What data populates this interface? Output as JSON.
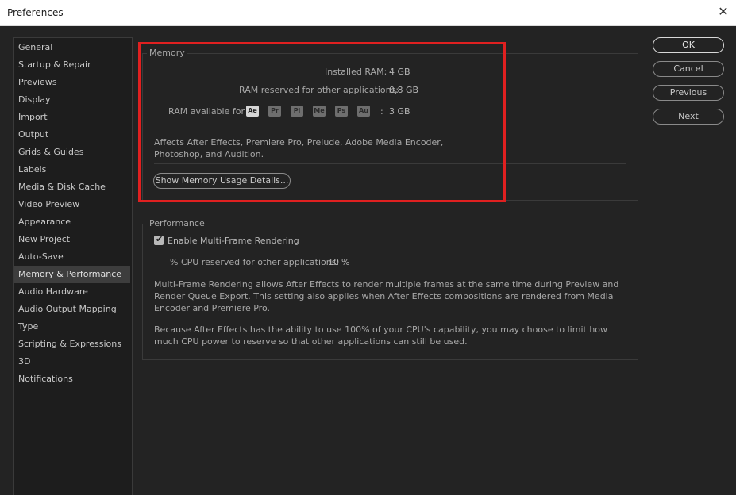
{
  "window": {
    "title": "Preferences"
  },
  "sidebar": {
    "items": [
      {
        "label": "General"
      },
      {
        "label": "Startup & Repair"
      },
      {
        "label": "Previews"
      },
      {
        "label": "Display"
      },
      {
        "label": "Import"
      },
      {
        "label": "Output"
      },
      {
        "label": "Grids & Guides"
      },
      {
        "label": "Labels"
      },
      {
        "label": "Media & Disk Cache"
      },
      {
        "label": "Video Preview"
      },
      {
        "label": "Appearance"
      },
      {
        "label": "New Project"
      },
      {
        "label": "Auto-Save"
      },
      {
        "label": "Memory & Performance"
      },
      {
        "label": "Audio Hardware"
      },
      {
        "label": "Audio Output Mapping"
      },
      {
        "label": "Type"
      },
      {
        "label": "Scripting & Expressions"
      },
      {
        "label": "3D"
      },
      {
        "label": "Notifications"
      }
    ],
    "selected": "Memory & Performance"
  },
  "memory": {
    "title": "Memory",
    "installed_label": "Installed RAM:",
    "installed_value": "4 GB",
    "reserved_label": "RAM reserved for other applications:",
    "reserved_value": "0,8 GB",
    "available_label": "RAM available for",
    "apps": [
      "Ae",
      "Pr",
      "Pl",
      "Me",
      "Ps",
      "Au"
    ],
    "available_sep": ":",
    "available_value": "3 GB",
    "desc_line1": "Affects After Effects, Premiere Pro, Prelude, Adobe Media Encoder,",
    "desc_line2": "Photoshop, and Audition.",
    "details_button": "Show Memory Usage Details..."
  },
  "performance": {
    "title": "Performance",
    "mfr_label": "Enable Multi-Frame Rendering",
    "mfr_checked": true,
    "cpu_label": "% CPU reserved for other applications:",
    "cpu_value": "10",
    "cpu_unit": "%",
    "para1_line1": "Multi-Frame Rendering allows After Effects to render multiple frames at the same time during Preview and",
    "para1_line2": "Render Queue Export. This setting also applies when After Effects compositions are rendered from Media",
    "para1_line3": "Encoder and Premiere Pro.",
    "para2_line1": "Because After Effects has the ability to use 100% of your CPU's capability, you may choose to limit how",
    "para2_line2": "much CPU power to reserve so that other applications can still be used."
  },
  "buttons": {
    "ok": "OK",
    "cancel": "Cancel",
    "previous": "Previous",
    "next": "Next"
  },
  "colors": {
    "highlight": "#e02020",
    "background": "#232323"
  }
}
